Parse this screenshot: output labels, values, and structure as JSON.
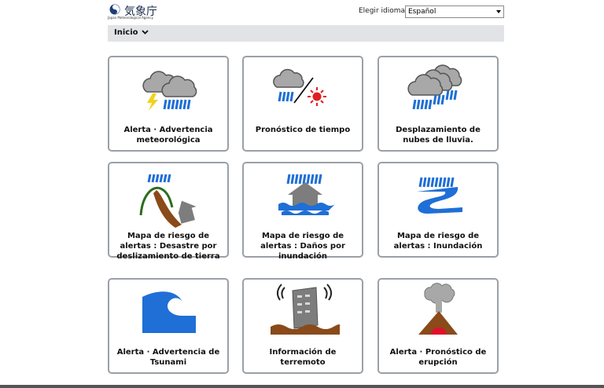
{
  "header": {
    "logo_text": "気象庁",
    "logo_subtext": "Japan Meteorological Agency",
    "language_label": "Elegir idioma",
    "language_selected": "Español"
  },
  "nav": {
    "home_label": "Inicio"
  },
  "tiles": [
    {
      "label": "Alerta · Advertencia meteorológica",
      "icon": "storm-warning-icon"
    },
    {
      "label": "Pronóstico de tiempo",
      "icon": "weather-forecast-icon"
    },
    {
      "label": "Desplazamiento de nubes de lluvia.",
      "icon": "rain-clouds-icon"
    },
    {
      "label": "Mapa de riesgo de alertas : Desastre por deslizamiento de tierra",
      "icon": "landslide-icon"
    },
    {
      "label": "Mapa de riesgo de alertas : Daños por inundación",
      "icon": "house-flood-icon"
    },
    {
      "label": "Mapa de riesgo de alertas : Inundación",
      "icon": "river-flood-icon"
    },
    {
      "label": "Alerta · Advertencia de Tsunami",
      "icon": "tsunami-icon"
    },
    {
      "label": "Información de terremoto",
      "icon": "earthquake-icon"
    },
    {
      "label": "Alerta · Pronóstico de erupción",
      "icon": "volcano-icon"
    }
  ],
  "colors": {
    "rain": "#1f6fd6",
    "cloud": "#9a9a9a",
    "nav_bg": "#e1e3e6",
    "border": "#9aa0a6"
  }
}
